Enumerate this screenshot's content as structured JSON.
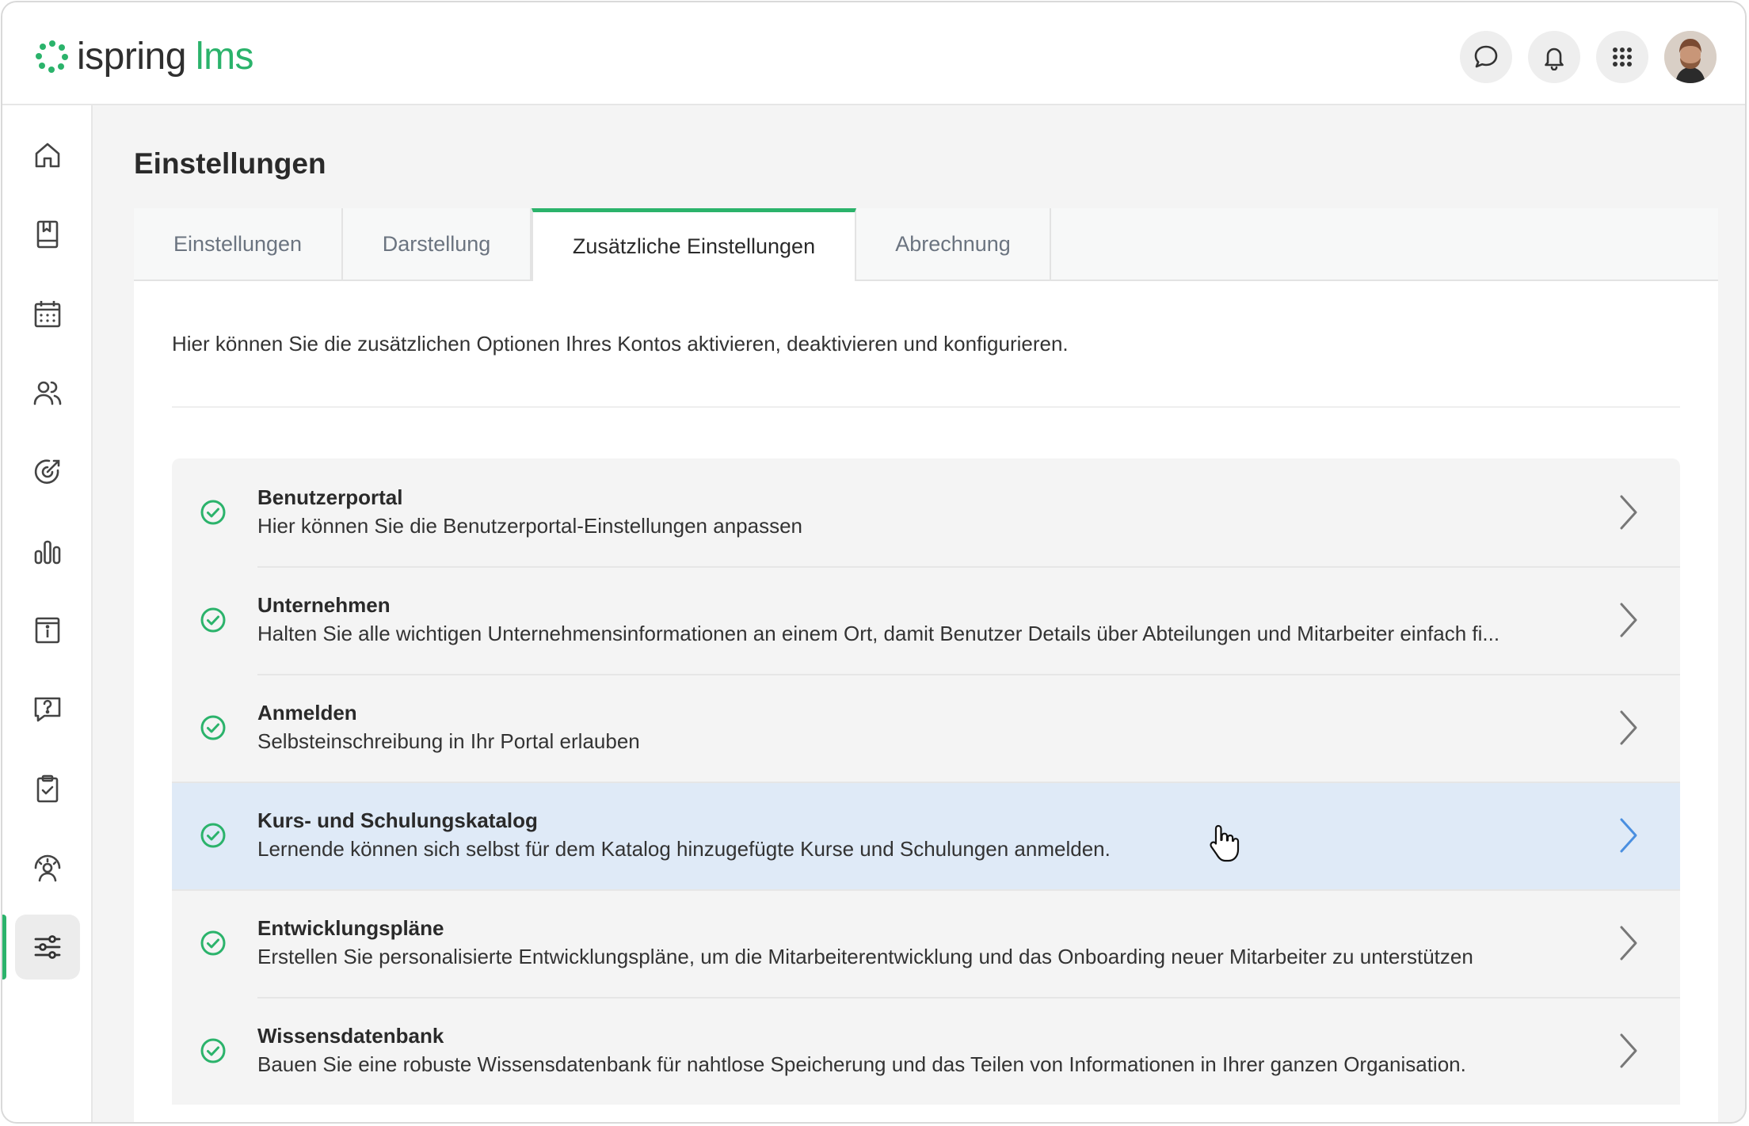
{
  "brand": {
    "word": "ispring",
    "suffix": "lms",
    "color": "#2bb36b"
  },
  "header_icons": [
    "chat-bubble-icon",
    "bell-icon",
    "apps-grid-icon"
  ],
  "sidebar": {
    "items": [
      {
        "name": "home-icon"
      },
      {
        "name": "book-icon"
      },
      {
        "name": "calendar-icon"
      },
      {
        "name": "users-icon"
      },
      {
        "name": "target-icon"
      },
      {
        "name": "bar-chart-icon"
      },
      {
        "name": "info-box-icon"
      },
      {
        "name": "question-chat-icon"
      },
      {
        "name": "clipboard-check-icon"
      },
      {
        "name": "person-gauge-icon"
      },
      {
        "name": "sliders-icon",
        "active": true
      }
    ]
  },
  "page": {
    "title": "Einstellungen"
  },
  "tabs": [
    {
      "label": "Einstellungen",
      "active": false
    },
    {
      "label": "Darstellung",
      "active": false
    },
    {
      "label": "Zusätzliche Einstellungen",
      "active": true
    },
    {
      "label": "Abrechnung",
      "active": false
    }
  ],
  "intro": "Hier können Sie die zusätzlichen Optionen Ihres Kontos aktivieren, deaktivieren und konfigurieren.",
  "options": [
    {
      "title": "Benutzerportal",
      "desc": "Hier können Sie die Benutzerportal-Einstellungen anpassen",
      "enabled": true
    },
    {
      "title": "Unternehmen",
      "desc": "Halten Sie alle wichtigen Unternehmensinformationen an einem Ort, damit Benutzer Details über Abteilungen und Mitarbeiter einfach fi...",
      "enabled": true
    },
    {
      "title": "Anmelden",
      "desc": "Selbsteinschreibung in Ihr Portal erlauben",
      "enabled": true
    },
    {
      "title": "Kurs- und Schulungskatalog",
      "desc": "Lernende können sich selbst für dem Katalog hinzugefügte Kurse und Schulungen anmelden.",
      "enabled": true,
      "hovered": true
    },
    {
      "title": "Entwicklungspläne",
      "desc": "Erstellen Sie personalisierte Entwicklungspläne, um die Mitarbeiterentwicklung und das Onboarding neuer Mitarbeiter zu unterstützen",
      "enabled": true
    },
    {
      "title": "Wissensdatenbank",
      "desc": "Bauen Sie eine robuste Wissensdatenbank für nahtlose Speicherung und das Teilen von Informationen in Ihrer ganzen Organisation.",
      "enabled": true
    }
  ],
  "colors": {
    "accent": "#2bb36b",
    "hover_row": "#dfeaf7",
    "chevron_hover": "#4a8fe0"
  }
}
